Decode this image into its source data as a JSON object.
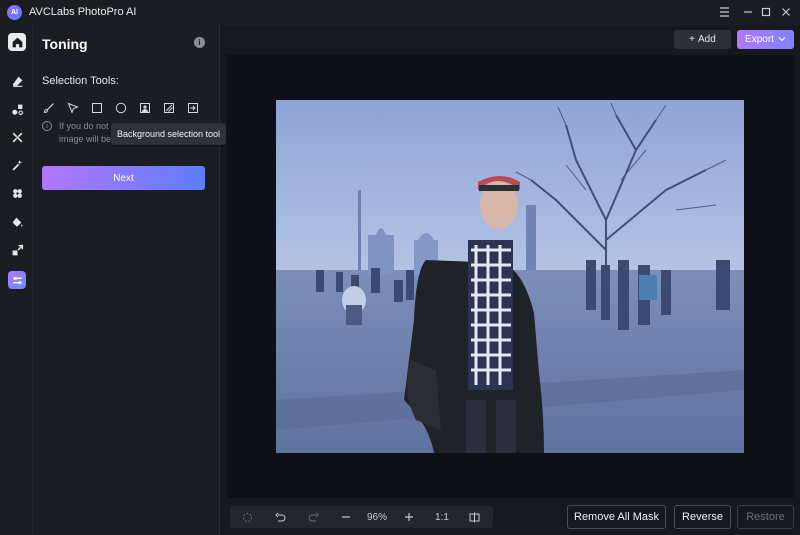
{
  "app": {
    "title": "AVCLabs PhotoPro AI",
    "logo_text": "AI"
  },
  "window_controls": [
    "menu-icon",
    "minimize-icon",
    "maximize-icon",
    "close-icon"
  ],
  "rail": {
    "items": [
      {
        "name": "home",
        "icon": "home-icon",
        "active": false
      },
      {
        "name": "eraser",
        "icon": "eraser-icon",
        "active": false
      },
      {
        "name": "shapes",
        "icon": "shapes-icon",
        "active": false
      },
      {
        "name": "enhance",
        "icon": "enhance-icon",
        "active": false
      },
      {
        "name": "magic",
        "icon": "magic-icon",
        "active": false
      },
      {
        "name": "flower",
        "icon": "flower-icon",
        "active": false
      },
      {
        "name": "paint",
        "icon": "paint-bucket-icon",
        "active": false
      },
      {
        "name": "resize",
        "icon": "resize-icon",
        "active": false
      },
      {
        "name": "toning",
        "icon": "toning-icon",
        "active": true
      }
    ]
  },
  "panel": {
    "title": "Toning",
    "section_label": "Selection Tools:",
    "tools": [
      "brush-icon",
      "pointer-select-icon",
      "rectangle-select-icon",
      "ellipse-select-icon",
      "portrait-select-icon",
      "background-select-icon",
      "import-mask-icon"
    ],
    "hint_line1": "If you do not",
    "hint_line2": "image will be",
    "tooltip": "Background selection tool",
    "next_label": "Next"
  },
  "toolbar": {
    "add_label": "Add",
    "export_label": "Export"
  },
  "bottom": {
    "zoom": "96%",
    "ratio": "1:1",
    "remove_all_mask": "Remove All Mask",
    "reverse": "Reverse",
    "restore": "Restore"
  },
  "colors": {
    "accent_start": "#b277ff",
    "accent_end": "#5d7dff",
    "background": "#16181d"
  }
}
